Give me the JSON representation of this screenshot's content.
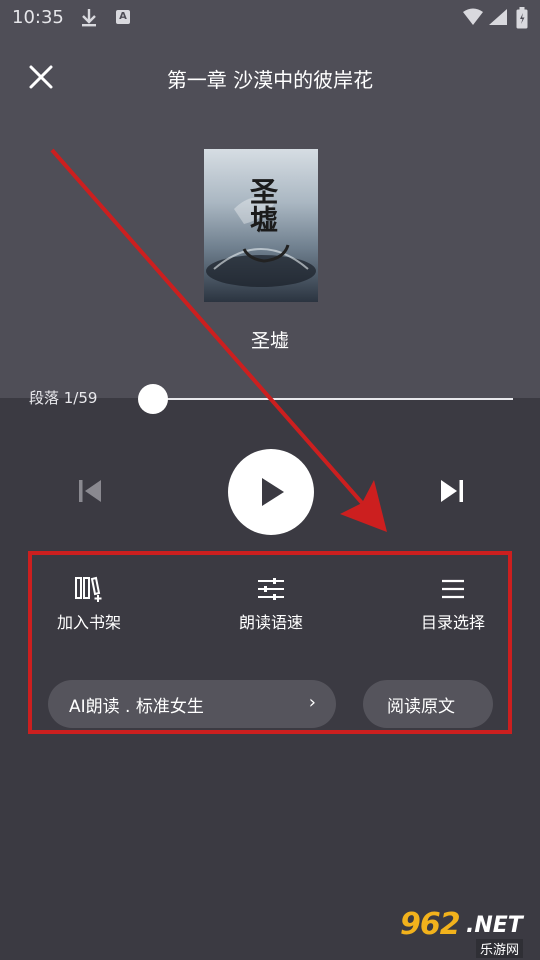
{
  "status_bar": {
    "time": "10:35"
  },
  "header": {
    "title": "第一章 沙漠中的彼岸花"
  },
  "book": {
    "name": "圣墟",
    "cover_text": "圣墟"
  },
  "progress": {
    "label": "段落 1/59",
    "current": 1,
    "total": 59
  },
  "tools": [
    {
      "label": "加入书架",
      "icon": "bookshelf-add-icon"
    },
    {
      "label": "朗读语速",
      "icon": "sliders-icon"
    },
    {
      "label": "目录选择",
      "icon": "menu-list-icon"
    }
  ],
  "voice_pill": {
    "label": "AI朗读 . 标准女生",
    "chevron": "›"
  },
  "read_original": {
    "label": "阅读原文"
  },
  "watermark": {
    "num": "962",
    "net": ".NET",
    "cn": "乐游网"
  },
  "colors": {
    "top_bg": "#4f4e57",
    "bottom_bg": "#3b3a42",
    "annotation": "#cc1f1f",
    "watermark": "#f2b21c"
  }
}
